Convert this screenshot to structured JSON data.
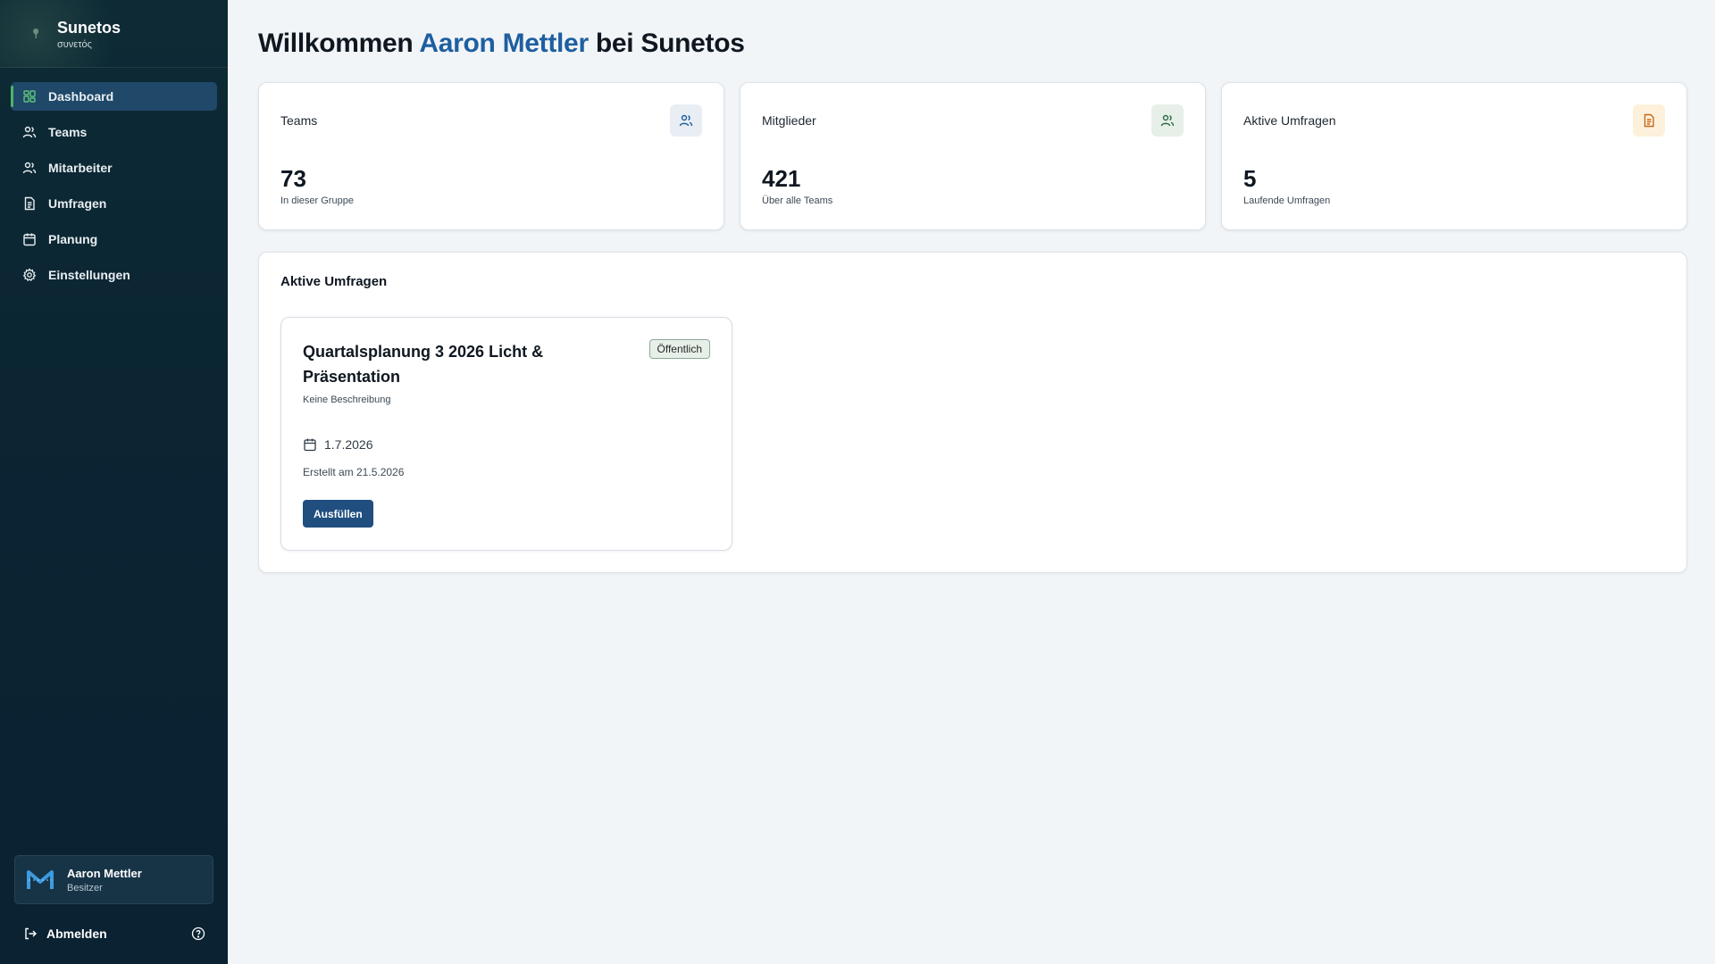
{
  "brand": {
    "name": "Sunetos",
    "subtitle": "συνετός"
  },
  "nav": {
    "items": [
      {
        "label": "Dashboard",
        "icon": "dashboard-icon",
        "active": true
      },
      {
        "label": "Teams",
        "icon": "users-icon"
      },
      {
        "label": "Mitarbeiter",
        "icon": "users-icon"
      },
      {
        "label": "Umfragen",
        "icon": "document-icon"
      },
      {
        "label": "Planung",
        "icon": "calendar-icon"
      },
      {
        "label": "Einstellungen",
        "icon": "gear-icon"
      }
    ]
  },
  "user": {
    "name": "Aaron Mettler",
    "role": "Besitzer",
    "avatar_icon": "m-logo-icon"
  },
  "footer": {
    "logout_label": "Abmelden",
    "help_icon": "help-circle-icon"
  },
  "header": {
    "prefix": "Willkommen",
    "user_name": "Aaron Mettler",
    "suffix": "bei Sunetos"
  },
  "stats": [
    {
      "title": "Teams",
      "value": "73",
      "sub": "In dieser Gruppe",
      "icon": "users-icon",
      "icon_bg": "#e9eef4",
      "icon_color": "#1e5fa0"
    },
    {
      "title": "Mitglieder",
      "value": "421",
      "sub": "Über alle Teams",
      "icon": "users-icon",
      "icon_bg": "#e6efe8",
      "icon_color": "#2f6b45"
    },
    {
      "title": "Aktive Umfragen",
      "value": "5",
      "sub": "Laufende Umfragen",
      "icon": "document-icon",
      "icon_bg": "#fdf1dc",
      "icon_color": "#c8691a"
    }
  ],
  "section": {
    "title": "Aktive Umfragen",
    "survey": {
      "title": "Quartalsplanung 3 2026 Licht & Präsentation",
      "badge": "Öffentlich",
      "description": "Keine Beschreibung",
      "date": "1.7.2026",
      "created": "Erstellt am 21.5.2026",
      "button_label": "Ausfüllen"
    }
  },
  "colors": {
    "accent": "#1e5fa0",
    "sidebar_active": "#1f4869",
    "active_marker": "#4fb36a",
    "button": "#1f4e7f"
  }
}
